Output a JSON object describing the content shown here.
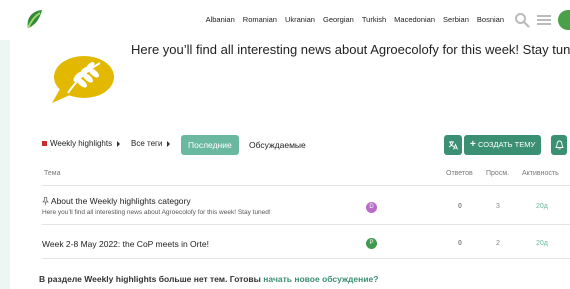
{
  "header": {
    "languages": [
      "Albanian",
      "Romanian",
      "Ukranian",
      "Georgian",
      "Turkish",
      "Macedonian",
      "Serbian",
      "Bosnian"
    ],
    "icons": [
      "search-icon",
      "hamburger-menu-icon",
      "user-avatar"
    ]
  },
  "banner": {
    "text": "Here you’ll find all interesting news about Agroecolofy for this week! Stay tuned!"
  },
  "nav": {
    "category": "Weekly highlights",
    "tags": "Все теги",
    "tab_latest": "Последние",
    "tab_top": "Обсуждаемые",
    "create_label": "СОЗДАТЬ ТЕМУ"
  },
  "table": {
    "col_topic": "Тема",
    "col_replies": "Ответов",
    "col_views": "Просм.",
    "col_activity": "Активность",
    "rows": [
      {
        "title": "About the Weekly highlights category",
        "excerpt": "Here you’ll find all interesting news about Agroecolofy for this week! Stay tuned!",
        "user_initial": "D",
        "user_color": "#b86bc9",
        "replies": "0",
        "views": "3",
        "activity": "20д"
      },
      {
        "title": "Week 2-8 May 2022: the CoP meets in Orte!",
        "excerpt": "",
        "user_initial": "P",
        "user_color": "#3f9a4f",
        "replies": "0",
        "views": "2",
        "activity": "20д"
      }
    ]
  },
  "footer": {
    "message": "В разделе Weekly highlights больше нет тем. Готовы",
    "link": "начать новое обсуждение?"
  },
  "colors": {
    "accent": "#3b8f72",
    "accent_light": "#6bb8a0",
    "category": "#c9302c"
  }
}
